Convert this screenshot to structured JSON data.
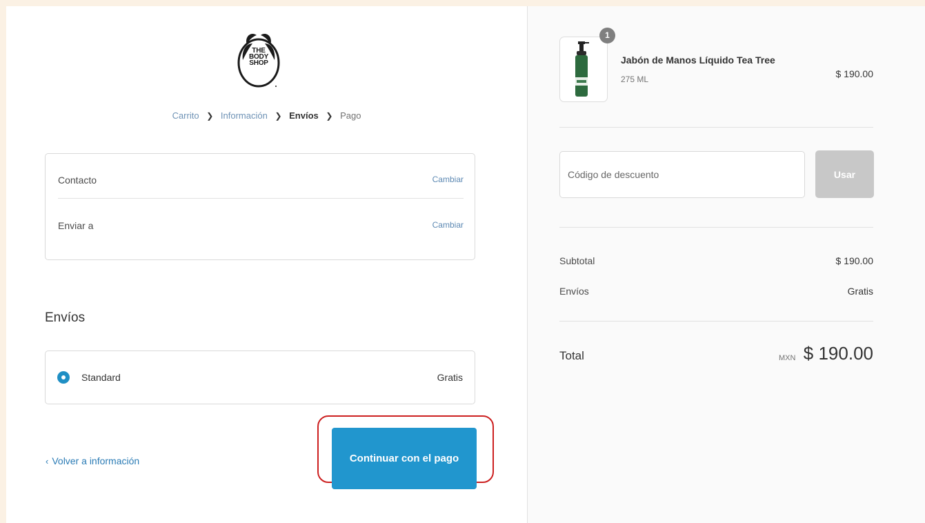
{
  "brand": {
    "logo_lines": [
      "THE",
      "BODY",
      "SHOP"
    ]
  },
  "breadcrumb": {
    "items": [
      "Carrito",
      "Información",
      "Envíos",
      "Pago"
    ],
    "separator": "❯"
  },
  "review": {
    "contact_label": "Contacto",
    "contact_change": "Cambiar",
    "shipto_label": "Enviar a",
    "shipto_change": "Cambiar"
  },
  "shipping": {
    "title": "Envíos",
    "method_name": "Standard",
    "method_price": "Gratis",
    "selected": true
  },
  "actions": {
    "back_chevron": "‹",
    "back_label": "Volver a información",
    "continue_label": "Continuar con el pago"
  },
  "order": {
    "product": {
      "name": "Jabón de Manos Líquido Tea Tree",
      "variant": "275 ML",
      "price": "$ 190.00",
      "quantity": "1",
      "image_icon": "green-soap-bottle-icon"
    },
    "discount": {
      "placeholder": "Código de descuento",
      "button_label": "Usar"
    },
    "summary": {
      "subtotal_label": "Subtotal",
      "subtotal_value": "$ 190.00",
      "shipping_label": "Envíos",
      "shipping_value": "Gratis",
      "total_label": "Total",
      "total_currency": "MXN",
      "total_value": "$ 190.00"
    }
  },
  "colors": {
    "accent": "#2196ce",
    "link": "#2a7bb5",
    "highlight": "#cc1f1f",
    "background_outer": "#fbf1e4",
    "sidebar": "#fafafa"
  }
}
